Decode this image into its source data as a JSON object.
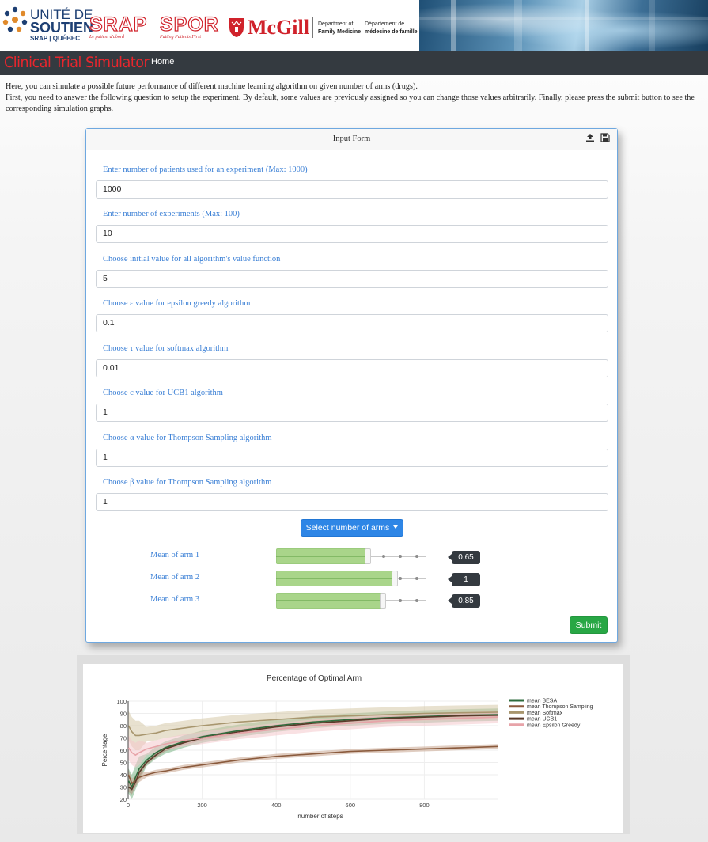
{
  "banner": {
    "unite": {
      "line1": "UNITÉ DE",
      "line2": "SOUTIEN",
      "line3": "SRAP | QUÉBEC"
    },
    "srap": {
      "word": "SRAP",
      "tagline": "Le patient d'abord"
    },
    "spor": {
      "word": "SPOR",
      "tagline": "Putting Patients First"
    },
    "mcgill": {
      "word": "McGill",
      "dept_en_1": "Department of",
      "dept_en_2": "Family Medicine",
      "dept_fr_1": "Département de",
      "dept_fr_2": "médecine de famille"
    }
  },
  "nav": {
    "brand": "Clinical Trial Simulator",
    "home": "Home"
  },
  "intro": {
    "line1": "Here, you can simulate a possible future performance of different machine learning algorithm on given number of arms (drugs).",
    "line2": "First, you need to answer the following question to setup the experiment. By default, some values are previously assigned so you can change those values arbitrarily. Finally, please press the submit button to see the corresponding simulation graphs."
  },
  "form": {
    "title": "Input Form",
    "fields": [
      {
        "label": "Enter number of patients used for an experiment (Max: 1000)",
        "value": "1000"
      },
      {
        "label": "Enter number of experiments (Max: 100)",
        "value": "10"
      },
      {
        "label": "Choose initial value for all algorithm's value function",
        "value": "5"
      },
      {
        "label": "Choose ε value for epsilon greedy algorithm",
        "value": "0.1"
      },
      {
        "label": "Choose τ value for softmax algorithm",
        "value": "0.01"
      },
      {
        "label": "Choose c value for UCB1 algorithm",
        "value": "1"
      },
      {
        "label": "Choose α value for Thompson Sampling algorithm",
        "value": "1"
      },
      {
        "label": "Choose β value for Thompson Sampling algorithm",
        "value": "1"
      }
    ],
    "select_arms_label": "Select number of arms",
    "arms": [
      {
        "label": "Mean of arm 1",
        "value": "0.65",
        "level": 0.65
      },
      {
        "label": "Mean of arm 2",
        "value": "1",
        "level": 1.0
      },
      {
        "label": "Mean of arm 3",
        "value": "0.85",
        "level": 0.85
      }
    ],
    "submit_label": "Submit"
  },
  "chart_data": {
    "type": "line",
    "title": "Percentage of Optimal Arm",
    "xlabel": "number of steps",
    "ylabel": "Percentage",
    "xlim": [
      0,
      1000
    ],
    "ylim": [
      20,
      100
    ],
    "xticks": [
      200,
      400,
      600,
      800
    ],
    "yticks": [
      20,
      30,
      40,
      50,
      60,
      70,
      80,
      90,
      100
    ],
    "grid": true,
    "legend_position": "top-right",
    "series": [
      {
        "name": "mean BESA",
        "color": "#2e6b3c",
        "band": "#7ab585",
        "x": [
          1,
          10,
          20,
          30,
          50,
          75,
          100,
          150,
          200,
          300,
          400,
          500,
          600,
          700,
          800,
          900,
          1000
        ],
        "y": [
          35,
          30,
          38,
          45,
          52,
          58,
          62,
          67,
          71,
          76,
          80,
          83,
          85,
          86.5,
          87.5,
          88.5,
          89
        ]
      },
      {
        "name": "mean Thompson Sampling",
        "color": "#8a5a3c",
        "band": "#c9a58f",
        "x": [
          1,
          10,
          20,
          30,
          50,
          75,
          100,
          150,
          200,
          300,
          400,
          500,
          600,
          700,
          800,
          900,
          1000
        ],
        "y": [
          40,
          33,
          35,
          38,
          40,
          42,
          43,
          46,
          48,
          52,
          55,
          57,
          59,
          60,
          61,
          62,
          63
        ]
      },
      {
        "name": "mean Softmax",
        "color": "#a8966e",
        "band": "#d6c8a8",
        "x": [
          1,
          10,
          20,
          30,
          50,
          75,
          100,
          150,
          200,
          300,
          400,
          500,
          600,
          700,
          800,
          900,
          1000
        ],
        "y": [
          80,
          75,
          72,
          72,
          73,
          74,
          76,
          78,
          80,
          83,
          85,
          87,
          88,
          89,
          90,
          90.5,
          91
        ]
      },
      {
        "name": "mean UCB1",
        "color": "#5a3a2a",
        "band": "#b08b78",
        "x": [
          1,
          10,
          20,
          30,
          50,
          75,
          100,
          150,
          200,
          300,
          400,
          500,
          600,
          700,
          800,
          900,
          1000
        ],
        "y": [
          30,
          28,
          34,
          42,
          50,
          56,
          61,
          66,
          70,
          75,
          79,
          82,
          84,
          86,
          87,
          88,
          88.5
        ]
      },
      {
        "name": "mean Epsilon Greedy",
        "color": "#e7a3a8",
        "band": "#f4c9cc",
        "x": [
          1,
          10,
          20,
          30,
          50,
          75,
          100,
          150,
          200,
          300,
          400,
          500,
          600,
          700,
          800,
          900,
          1000
        ],
        "y": [
          62,
          58,
          56,
          58,
          61,
          63,
          65,
          68,
          70,
          74,
          77,
          80,
          82,
          84,
          85,
          86,
          87
        ]
      }
    ]
  }
}
